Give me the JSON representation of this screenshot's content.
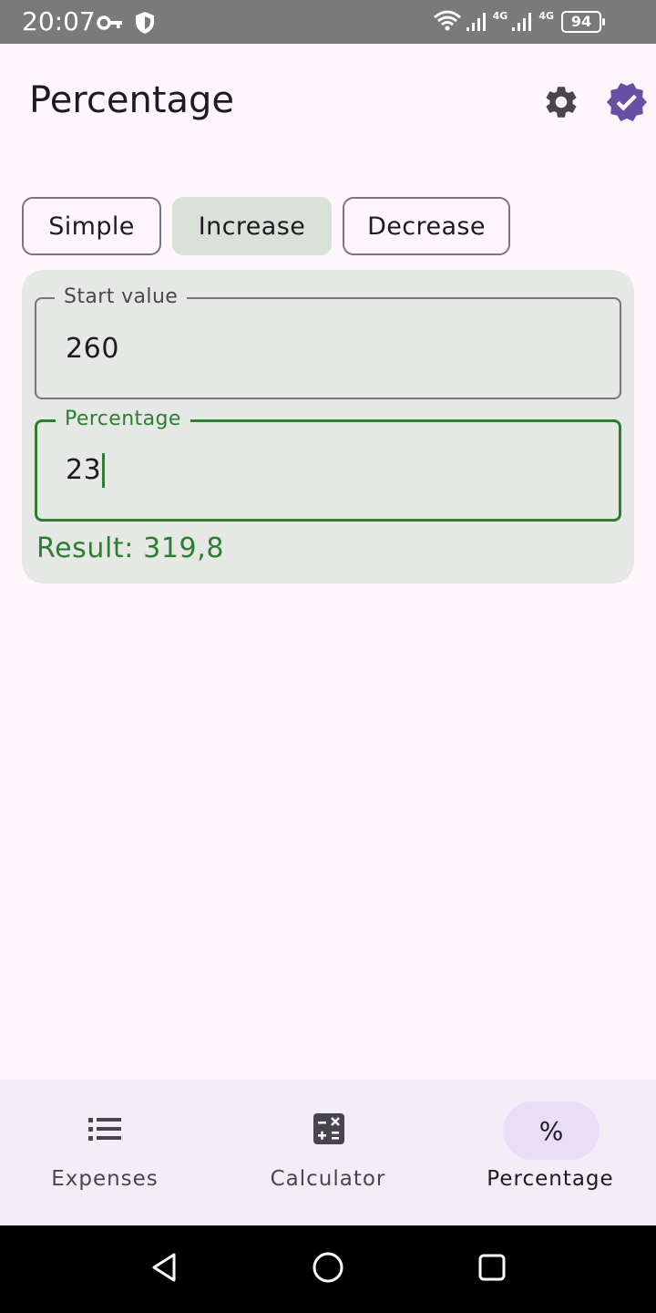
{
  "status_bar": {
    "time": "20:07",
    "left_icons": [
      "key-icon",
      "shield-icon"
    ],
    "network_labels": [
      "4G",
      "4G"
    ],
    "battery": "94"
  },
  "app_bar": {
    "title": "Percentage",
    "icons": [
      "gear-icon",
      "verified-badge-icon"
    ],
    "accent_color": "#6750a4"
  },
  "tabs": [
    {
      "label": "Simple",
      "selected": false
    },
    {
      "label": "Increase",
      "selected": true
    },
    {
      "label": "Decrease",
      "selected": false
    }
  ],
  "form": {
    "start_value": {
      "label": "Start value",
      "value": "260"
    },
    "percentage": {
      "label": "Percentage",
      "value": "23"
    },
    "result": "Result: 319,8",
    "accent_color": "#2e7d32"
  },
  "bottom_nav": {
    "items": [
      {
        "label": "Expenses",
        "icon": "list-icon",
        "selected": false
      },
      {
        "label": "Calculator",
        "icon": "calculator-icon",
        "selected": false
      },
      {
        "label": "Percentage",
        "icon": "percent-icon",
        "icon_glyph": "%",
        "selected": true
      }
    ]
  },
  "system_nav": {
    "icons": [
      "back-icon",
      "home-icon",
      "recents-icon"
    ]
  }
}
